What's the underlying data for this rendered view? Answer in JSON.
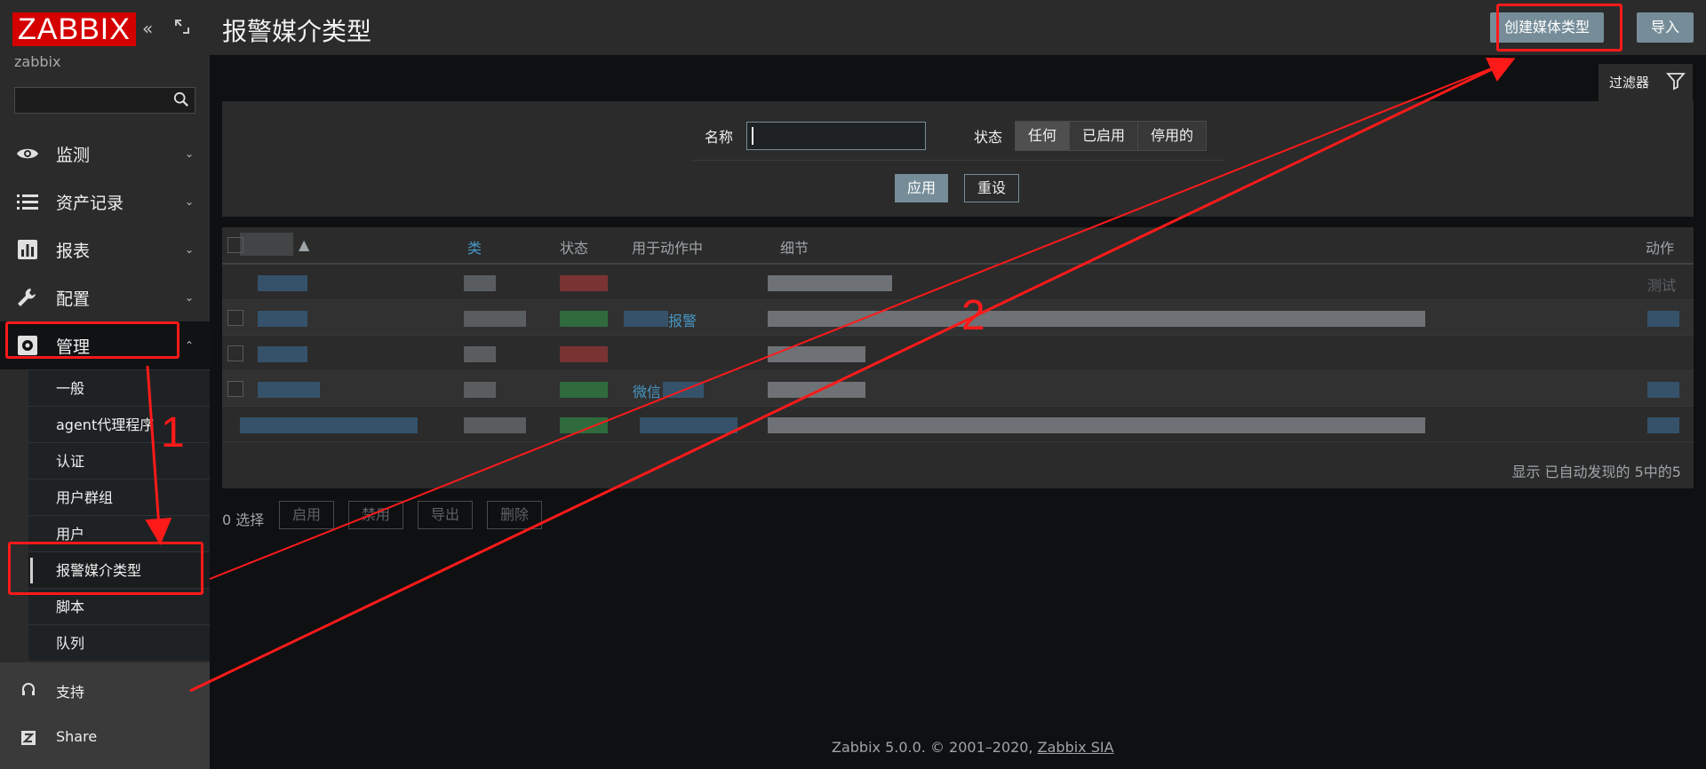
{
  "app": {
    "logo": "ZABBIX",
    "server_name": "zabbix"
  },
  "sidebar": {
    "search_placeholder": "",
    "menu": [
      {
        "label": "监测",
        "icon": "eye-icon"
      },
      {
        "label": "资产记录",
        "icon": "list-icon"
      },
      {
        "label": "报表",
        "icon": "bar-chart-icon"
      },
      {
        "label": "配置",
        "icon": "wrench-icon"
      },
      {
        "label": "管理",
        "icon": "gear-icon"
      }
    ],
    "submenu": [
      "一般",
      "agent代理程序",
      "认证",
      "用户群组",
      "用户",
      "报警媒介类型",
      "脚本",
      "队列"
    ],
    "bottom": [
      {
        "label": "支持",
        "icon": "headset-icon"
      },
      {
        "label": "Share",
        "icon": "share-z-icon"
      }
    ]
  },
  "header": {
    "title": "报警媒介类型",
    "create_button": "创建媒体类型",
    "import_button": "导入"
  },
  "filter": {
    "tab_label": "过滤器",
    "name_label": "名称",
    "name_value": "",
    "status_label": "状态",
    "status_options": [
      "任何",
      "已启用",
      "停用的"
    ],
    "status_selected": "任何",
    "apply": "应用",
    "reset": "重设"
  },
  "table": {
    "columns": {
      "type": "类",
      "status": "状态",
      "used_in_actions": "用于动作中",
      "details": "细节",
      "action": "动作"
    },
    "rows": [
      {
        "used_in": "",
        "action": "测试"
      },
      {
        "used_in": "报警",
        "action": ""
      },
      {
        "used_in": "",
        "action": ""
      },
      {
        "used_in": "微信",
        "action": ""
      },
      {
        "used_in": "",
        "action": ""
      }
    ],
    "footer": "显示 已自动发现的 5中的5"
  },
  "mass_actions": {
    "selected": "0 选择",
    "buttons": [
      "启用",
      "禁用",
      "导出",
      "删除"
    ]
  },
  "footer": {
    "text": "Zabbix 5.0.0. © 2001–2020, ",
    "link": "Zabbix SIA"
  },
  "annotations": {
    "step1": "1",
    "step2": "2",
    "color": "#ff1a1a"
  },
  "colors": {
    "accent": "#768d99",
    "link": "#4796c4",
    "logo_red": "#d40000"
  }
}
